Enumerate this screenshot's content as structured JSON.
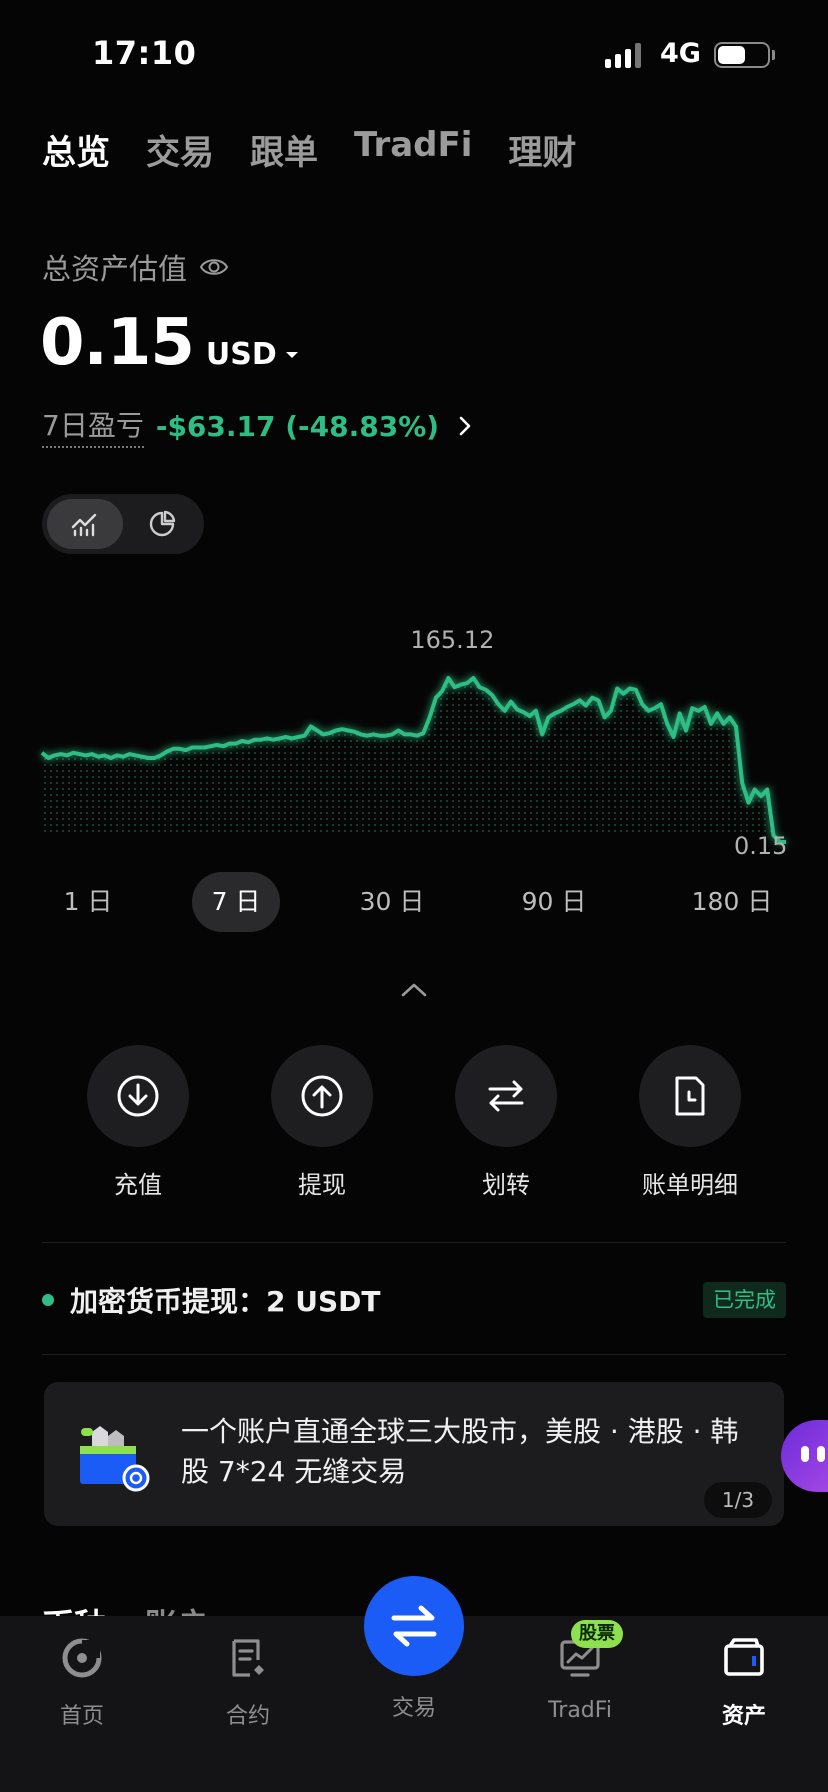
{
  "status_bar": {
    "time": "17:10",
    "network": "4G"
  },
  "top_tabs": [
    {
      "label": "总览",
      "active": true
    },
    {
      "label": "交易",
      "active": false
    },
    {
      "label": "跟单",
      "active": false
    },
    {
      "label": "TradFi",
      "active": false
    },
    {
      "label": "理财",
      "active": false
    }
  ],
  "summary": {
    "label": "总资产估值",
    "value": "0.15",
    "currency": "USD",
    "pnl_label": "7日盈亏",
    "pnl_value": "-$63.17 (-48.83%)"
  },
  "chart": {
    "max_label": "165.12",
    "min_label": "0.15",
    "line_color": "#2ebd85",
    "values": [
      108,
      104,
      106,
      107,
      106,
      108,
      107,
      106,
      107,
      105,
      106,
      104,
      106,
      105,
      107,
      106,
      105,
      104,
      104,
      106,
      109,
      111,
      111,
      110,
      112,
      112,
      112,
      113,
      114,
      113,
      115,
      115,
      117,
      116,
      118,
      118,
      119,
      118,
      119,
      120,
      119,
      120,
      121,
      128,
      125,
      122,
      123,
      125,
      126,
      125,
      124,
      122,
      121,
      122,
      121,
      121,
      122,
      125,
      122,
      122,
      121,
      123,
      135,
      150,
      155,
      165,
      158,
      160,
      161,
      165,
      158,
      156,
      152,
      145,
      140,
      147,
      141,
      139,
      136,
      140,
      122,
      135,
      138,
      140,
      143,
      145,
      148,
      144,
      150,
      148,
      135,
      140,
      157,
      153,
      157,
      156,
      145,
      140,
      142,
      145,
      130,
      120,
      138,
      125,
      142,
      140,
      143,
      130,
      138,
      130,
      135,
      128,
      85,
      70,
      80,
      75,
      80,
      45,
      40,
      40
    ]
  },
  "ranges": [
    {
      "label": "1 日",
      "active": false
    },
    {
      "label": "7 日",
      "active": true
    },
    {
      "label": "30 日",
      "active": false
    },
    {
      "label": "90 日",
      "active": false
    },
    {
      "label": "180 日",
      "active": false
    }
  ],
  "actions": [
    {
      "label": "充值",
      "icon": "deposit-icon"
    },
    {
      "label": "提现",
      "icon": "withdraw-icon"
    },
    {
      "label": "划转",
      "icon": "transfer-icon"
    },
    {
      "label": "账单明细",
      "icon": "bill-icon"
    }
  ],
  "notice": {
    "text": "加密货币提现：2 USDT",
    "status": "已完成"
  },
  "promo": {
    "text": "一个账户直通全球三大股市，美股 · 港股 · 韩股 7*24 无缝交易",
    "pager": "1/3"
  },
  "peek": {
    "title": "币种",
    "subtitle": "账户"
  },
  "bottom_nav": {
    "items": [
      {
        "label": "首页",
        "icon": "home-icon",
        "active": false
      },
      {
        "label": "合约",
        "icon": "contract-icon",
        "active": false
      },
      {
        "label": "交易",
        "icon": "trade-icon",
        "active": false
      },
      {
        "label": "TradFi",
        "icon": "tradfi-icon",
        "active": false,
        "badge": "股票"
      },
      {
        "label": "资产",
        "icon": "assets-icon",
        "active": true
      }
    ]
  }
}
